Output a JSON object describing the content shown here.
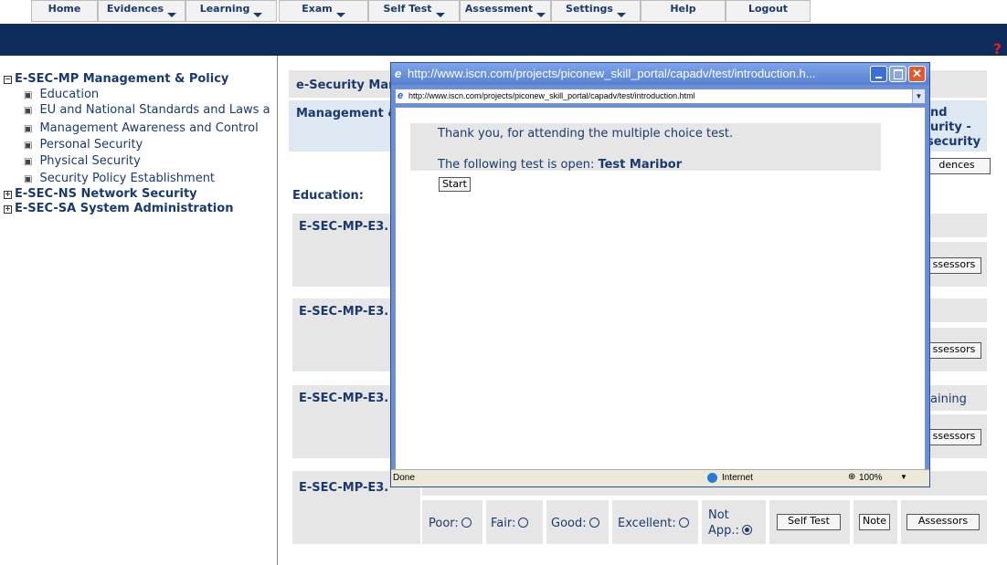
{
  "nav": {
    "items": [
      {
        "label": "Home",
        "dropdown": false
      },
      {
        "label": "Evidences",
        "dropdown": true
      },
      {
        "label": "Learning",
        "dropdown": true
      },
      {
        "label": "Exam",
        "dropdown": true
      },
      {
        "label": "Self Test",
        "dropdown": true
      },
      {
        "label": "Assessment",
        "dropdown": true
      },
      {
        "label": "Settings",
        "dropdown": true
      },
      {
        "label": "Help",
        "dropdown": false
      },
      {
        "label": "Logout",
        "dropdown": false
      }
    ],
    "help_symbol": "?"
  },
  "tree": {
    "root": {
      "toggle": "−",
      "label": "E-SEC-MP Management & Policy"
    },
    "children": [
      "Education",
      "EU and National Standards and Laws a",
      "Management Awareness and Control",
      "Personal Security",
      "Physical Security",
      "Security Policy Establishment"
    ],
    "collapsed": [
      {
        "toggle": "+",
        "label": "E-SEC-NS Network Security"
      },
      {
        "toggle": "+",
        "label": "E-SEC-SA System Administration"
      }
    ]
  },
  "main": {
    "header_title": "e-Security Mar",
    "sub_title": "Management &",
    "right_fragments": [
      "nd",
      "urity -",
      "security"
    ],
    "evidences_button": "dences",
    "section_title": "Education:",
    "units": [
      {
        "code": "E-SEC-MP-E3.",
        "right_text": "",
        "assessors": "ssessors"
      },
      {
        "code": "E-SEC-MP-E3.",
        "right_text": "",
        "assessors": "ssessors"
      },
      {
        "code": "E-SEC-MP-E3.",
        "right_text": "aining",
        "assessors": "ssessors"
      },
      {
        "code": "E-SEC-MP-E3.",
        "right_text": "",
        "assessors": "Assessors"
      }
    ],
    "rating": {
      "poor": "Poor:",
      "fair": "Fair:",
      "good": "Good:",
      "excellent": "Excellent:",
      "not_app": "Not App.:",
      "selected": "not_app"
    },
    "self_test_button": "Self Test",
    "note_button": "Note",
    "assessors_button": "Assessors"
  },
  "popup": {
    "title": "http://www.iscn.com/projects/piconew_skill_portal/capadv/test/introduction.h...",
    "address": "http://www.iscn.com/projects/piconew_skill_portal/capadv/test/introduction.html",
    "thank_you": "Thank you, for attending the multiple choice test.",
    "open_test_prefix": "The following test is open: ",
    "open_test_name": "Test Maribor",
    "start_button": "Start",
    "status_left": "Done",
    "status_zone": "Internet",
    "zoom": "100%"
  }
}
